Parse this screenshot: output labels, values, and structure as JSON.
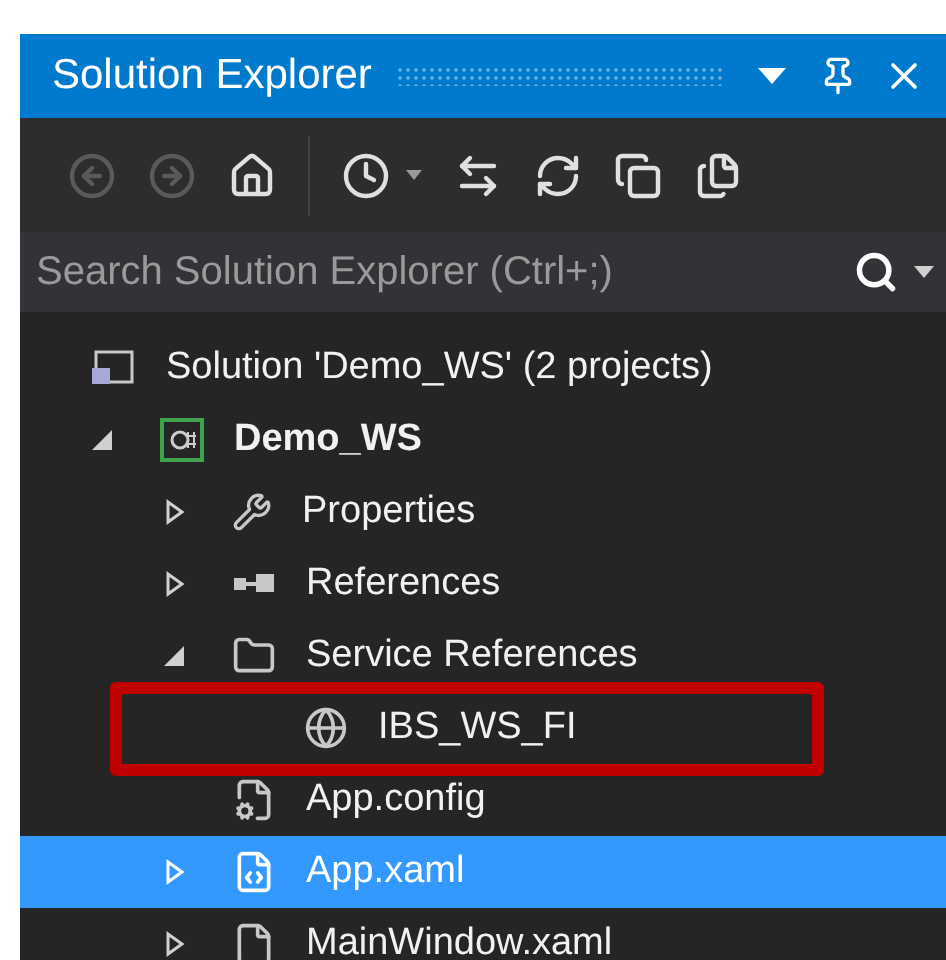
{
  "window": {
    "title": "Solution Explorer"
  },
  "toolbar": [
    {
      "kind": "back",
      "disabled": true
    },
    {
      "kind": "forward",
      "disabled": true
    },
    {
      "kind": "home",
      "disabled": false
    },
    {
      "kind": "pending",
      "disabled": false
    },
    {
      "kind": "sync",
      "disabled": false
    },
    {
      "kind": "refresh",
      "disabled": false
    },
    {
      "kind": "collapse",
      "disabled": false
    },
    {
      "kind": "copy",
      "disabled": false
    }
  ],
  "search": {
    "placeholder": "Search Solution Explorer (Ctrl+;)"
  },
  "tree": [
    {
      "label": "Solution 'Demo_WS' (2 projects)",
      "kind": "solution",
      "selected": false,
      "children": [
        {
          "label": "Demo_WS",
          "kind": "csproject",
          "bold": true,
          "expanded": true,
          "selected": false,
          "children": [
            {
              "label": "Properties",
              "kind": "wrench",
              "expanded": false,
              "selected": false
            },
            {
              "label": "References",
              "kind": "references",
              "expanded": false,
              "selected": false
            },
            {
              "label": "Service References",
              "kind": "folder",
              "expanded": true,
              "selected": false,
              "children": [
                {
                  "label": "IBS_WS_FI",
                  "kind": "service",
                  "selected": false,
                  "highlighted": true
                }
              ]
            },
            {
              "label": "App.config",
              "kind": "config",
              "selected": false
            },
            {
              "label": "App.xaml",
              "kind": "xaml",
              "expanded": false,
              "selected": true
            },
            {
              "label": "MainWindow.xaml",
              "kind": "file",
              "expanded": false,
              "selected": false
            }
          ]
        }
      ]
    }
  ]
}
